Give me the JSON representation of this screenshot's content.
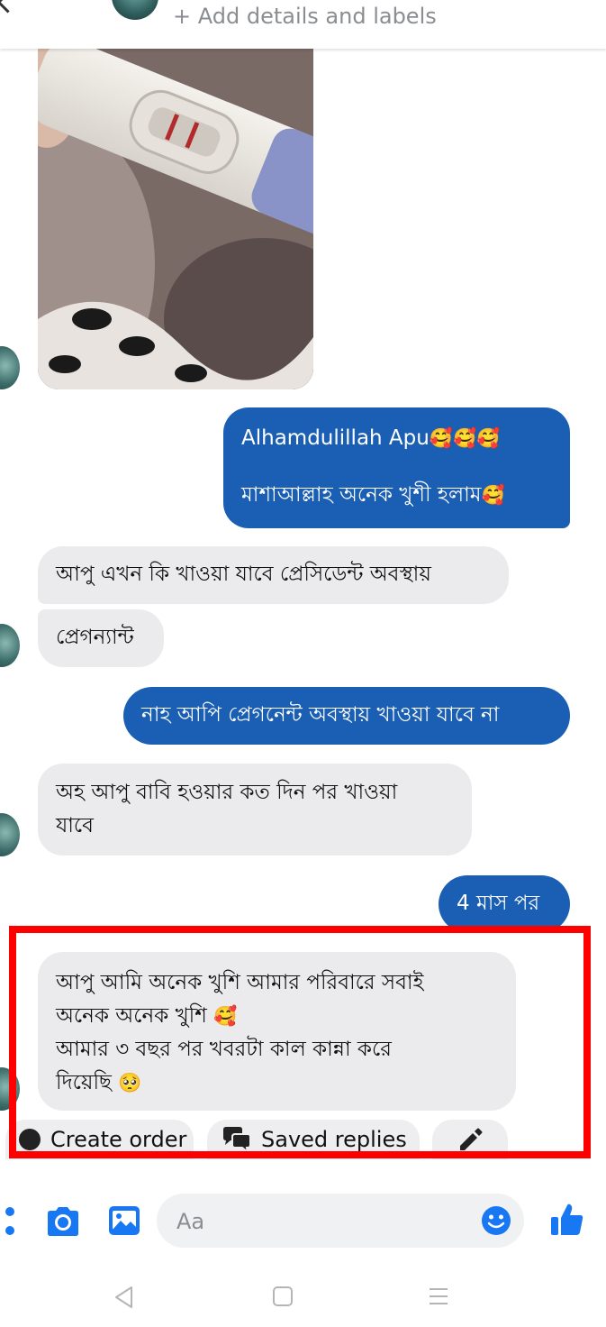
{
  "header": {
    "add_details": "+ Add details and labels"
  },
  "messages": {
    "out_1_line1": "Alhamdulillah Apu",
    "out_1_emoji1": "🥰🥰🥰",
    "out_1_line2": "মাশাআল্লাহ অনেক খুশী হলাম",
    "out_1_emoji2": "🥰",
    "in_1a": "আপু এখন কি খাওয়া যাবে প্রেসিডেন্ট অবস্থায়",
    "in_1b": "প্রেগন্যান্ট",
    "out_2": "নাহ আপি প্রেগনেন্ট অবস্থায় খাওয়া যাবে না",
    "in_2_line1": "অহ আপু বাবি হওয়ার কত দিন পর খাওয়া",
    "in_2_line2": "যাবে",
    "out_3": "4 মাস পর",
    "in_3_line1": "আপু আমি অনেক খুশি আমার পরিবারে সবাই",
    "in_3_line2": "অনেক অনেক খুশি",
    "in_3_emoji2": "🥰",
    "in_3_line3": "আমার ৩ বছর পর খবরটা কাল কান্না করে",
    "in_3_line4": "দিয়েছি",
    "in_3_emoji4": "🥺"
  },
  "quick_actions": {
    "create_order": "Create order",
    "saved_replies": "Saved replies"
  },
  "composer": {
    "placeholder": "Aa"
  },
  "colors": {
    "accent": "#1a5fb4",
    "icon_blue": "#1877f2",
    "highlight": "#ff0000"
  }
}
